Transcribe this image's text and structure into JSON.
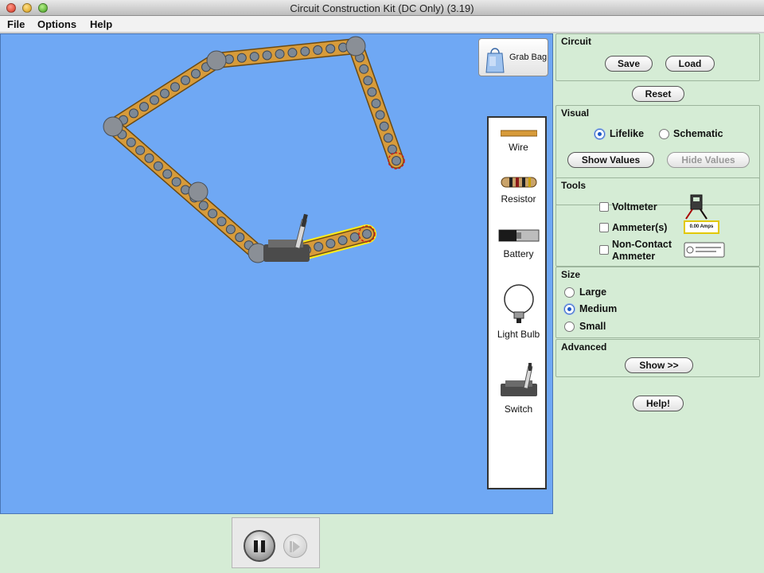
{
  "window": {
    "title": "Circuit Construction Kit (DC Only) (3.19)"
  },
  "menu": {
    "file": "File",
    "options": "Options",
    "help": "Help"
  },
  "grab_bag": {
    "label": "Grab Bag"
  },
  "toolbox": {
    "wire": "Wire",
    "resistor": "Resistor",
    "battery": "Battery",
    "light_bulb": "Light Bulb",
    "switch": "Switch"
  },
  "control": {
    "circuit": {
      "title": "Circuit",
      "save": "Save",
      "load": "Load"
    },
    "reset": "Reset",
    "visual": {
      "title": "Visual",
      "lifelike": "Lifelike",
      "schematic": "Schematic",
      "selected": "Lifelike",
      "show_values": "Show Values",
      "hide_values": "Hide Values"
    },
    "tools": {
      "title": "Tools",
      "voltmeter": "Voltmeter",
      "ammeters": "Ammeter(s)",
      "non_contact": "Non-Contact",
      "ammeter": "Ammeter",
      "ammeter_reading": "0.00 Amps"
    },
    "size": {
      "title": "Size",
      "large": "Large",
      "medium": "Medium",
      "small": "Small",
      "selected": "Medium"
    },
    "advanced": {
      "title": "Advanced",
      "show": "Show >>"
    },
    "help": "Help!"
  },
  "colors": {
    "play_area": "#6fa8f4",
    "panel": "#d5ecd5",
    "wire": "#d79b3a",
    "battery_highlight": "#ffec1a"
  }
}
